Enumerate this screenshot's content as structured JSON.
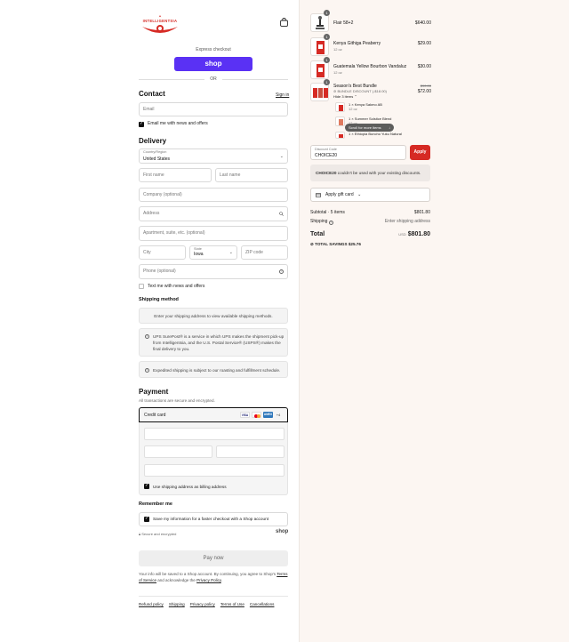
{
  "brand": {
    "name": "INTELLIGENTSIA",
    "accent": "#d62a24"
  },
  "header": {
    "cart_icon": "shopping-bag-icon"
  },
  "express": {
    "label": "Express checkout",
    "shop_label": "shop",
    "or_label": "OR"
  },
  "contact": {
    "title": "Contact",
    "signin_label": "Sign in",
    "email_placeholder": "Email",
    "news_label": "Email me with news and offers"
  },
  "delivery": {
    "title": "Delivery",
    "country_label": "Country/Region",
    "country_value": "United States",
    "first_name_placeholder": "First name",
    "last_name_placeholder": "Last name",
    "company_placeholder": "Company (optional)",
    "address_placeholder": "Address",
    "apartment_placeholder": "Apartment, suite, etc. (optional)",
    "city_placeholder": "City",
    "state_label": "State",
    "state_value": "Iowa",
    "zip_placeholder": "ZIP code",
    "phone_placeholder": "Phone (optional)",
    "text_news_label": "Text me with news and offers"
  },
  "shipping": {
    "title": "Shipping method",
    "placeholder_text": "Enter your shipping address to view available shipping methods.",
    "notice1": "UPS SurePost® is a service in which UPS makes the shipment pick-up from Intelligentsia, and the U.S. Postal Service® (USPS®) makes the final delivery to you.",
    "notice2": "Expedited shipping is subject to our roasting and fulfillment schedule."
  },
  "payment": {
    "title": "Payment",
    "subtitle": "All transactions are secure and encrypted.",
    "credit_card_label": "Credit card",
    "card_more": "+4",
    "billing_label": "Use shipping address as billing address"
  },
  "remember": {
    "title": "Remember me",
    "save_label": "Save my information for a faster checkout with a Shop account",
    "secure_label": "Secure and encrypted",
    "shop_logo": "shop"
  },
  "pay_now_label": "Pay now",
  "legal": {
    "prefix": "Your info will be saved to a Shop account. By continuing, you agree to Shop's ",
    "terms": "Terms of Service",
    "middle": " and acknowledge the ",
    "privacy": "Privacy Policy",
    "suffix": "."
  },
  "footer_links": [
    "Refund policy",
    "Shipping",
    "Privacy policy",
    "Terms of Use",
    "Cancellations"
  ],
  "cart": {
    "items": [
      {
        "qty": "1",
        "name": "Flair 58+2",
        "sub": "",
        "price": "$640.00"
      },
      {
        "qty": "1",
        "name": "Kenya Githiga Peaberry",
        "sub": "12 oz",
        "price": "$29.00"
      },
      {
        "qty": "1",
        "name": "Guatemala Yellow Bourbon Vandaluz",
        "sub": "12 oz",
        "price": "$30.00"
      }
    ],
    "bundle": {
      "qty": "1",
      "name": "Season's Best Bundle",
      "discount": "BUNDLE DISCOUNT (-$18.00)",
      "original_price": "$90.00",
      "price": "$72.00",
      "hide_label": "Hide 3 items",
      "subitems": [
        {
          "name": "1 × Kenya Sakmo AB",
          "sub": "12 oz"
        },
        {
          "name": "1 × Summer Solstice Blend",
          "sub": "12 oz"
        },
        {
          "name": "1 × Ethiopia Buncho Yuku Natural",
          "sub": ""
        }
      ],
      "tooltip": "Scroll for more items"
    },
    "discount_label": "Discount Code",
    "discount_value": "CHOICE20",
    "apply_label": "Apply",
    "error_code": "CHOICE20",
    "error_text": " couldn't be used with your existing discounts.",
    "gift_label": "Apply gift card",
    "subtotal_label": "Subtotal · 5 items",
    "subtotal_value": "$801.80",
    "shipping_label": "Shipping",
    "shipping_value": "Enter shipping address",
    "total_label": "Total",
    "currency": "USD",
    "total_value": "$801.80",
    "savings_label": "TOTAL SAVINGS",
    "savings_value": "$25.76"
  }
}
